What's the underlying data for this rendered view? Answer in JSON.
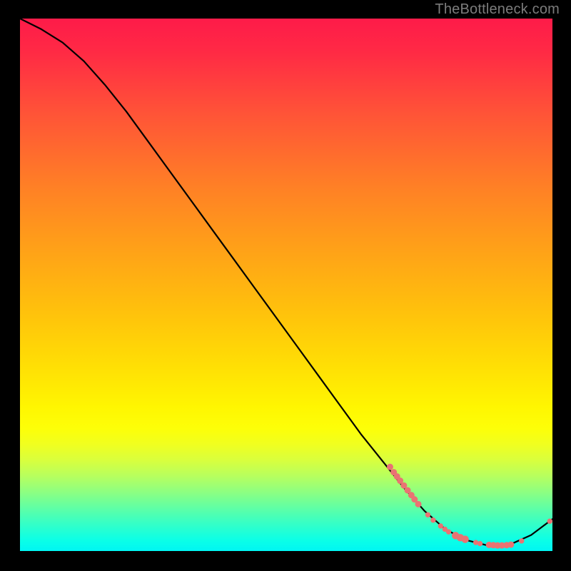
{
  "attribution": "TheBottleneck.com",
  "chart_data": {
    "type": "line",
    "title": "",
    "xlabel": "",
    "ylabel": "",
    "xlim": [
      0,
      100
    ],
    "ylim": [
      0,
      100
    ],
    "grid": false,
    "legend": false,
    "series": [
      {
        "name": "bottleneck-curve",
        "style": "line",
        "color": "#000000",
        "x": [
          0,
          4,
          8,
          12,
          16,
          20,
          24,
          28,
          32,
          36,
          40,
          44,
          48,
          52,
          56,
          60,
          64,
          68,
          72,
          76,
          80,
          84,
          88,
          92,
          96,
          100
        ],
        "y": [
          100,
          98,
          95.5,
          92,
          87.5,
          82.5,
          77,
          71.5,
          66,
          60.5,
          55,
          49.5,
          44,
          38.5,
          33,
          27.5,
          22,
          17,
          12,
          7.5,
          4,
          2,
          1,
          1.2,
          3,
          6
        ]
      },
      {
        "name": "markers",
        "style": "scatter",
        "color": "#e97373",
        "points": [
          {
            "x": 69.5,
            "y": 15.8,
            "r": 4.5
          },
          {
            "x": 70.2,
            "y": 14.8,
            "r": 4.5
          },
          {
            "x": 70.8,
            "y": 14.0,
            "r": 4.5
          },
          {
            "x": 71.4,
            "y": 13.2,
            "r": 4.5
          },
          {
            "x": 72.1,
            "y": 12.3,
            "r": 4.5
          },
          {
            "x": 72.8,
            "y": 11.4,
            "r": 4.5
          },
          {
            "x": 73.5,
            "y": 10.5,
            "r": 4.5
          },
          {
            "x": 74.1,
            "y": 9.7,
            "r": 4.5
          },
          {
            "x": 74.8,
            "y": 8.8,
            "r": 4.5
          },
          {
            "x": 76.6,
            "y": 6.8,
            "r": 3.7
          },
          {
            "x": 77.6,
            "y": 5.8,
            "r": 3.7
          },
          {
            "x": 79.0,
            "y": 4.7,
            "r": 3.7
          },
          {
            "x": 79.8,
            "y": 4.1,
            "r": 3.7
          },
          {
            "x": 80.5,
            "y": 3.6,
            "r": 3.7
          },
          {
            "x": 81.8,
            "y": 2.9,
            "r": 5.2
          },
          {
            "x": 82.7,
            "y": 2.5,
            "r": 5.2
          },
          {
            "x": 83.6,
            "y": 2.2,
            "r": 5.2
          },
          {
            "x": 85.6,
            "y": 1.6,
            "r": 3.7
          },
          {
            "x": 86.4,
            "y": 1.4,
            "r": 3.7
          },
          {
            "x": 88.1,
            "y": 1.15,
            "r": 4.5
          },
          {
            "x": 88.9,
            "y": 1.1,
            "r": 4.5
          },
          {
            "x": 89.7,
            "y": 1.05,
            "r": 4.5
          },
          {
            "x": 90.5,
            "y": 1.05,
            "r": 4.5
          },
          {
            "x": 91.4,
            "y": 1.1,
            "r": 4.5
          },
          {
            "x": 92.2,
            "y": 1.2,
            "r": 4.5
          },
          {
            "x": 94.2,
            "y": 1.9,
            "r": 3.7
          },
          {
            "x": 99.5,
            "y": 5.6,
            "r": 3.7
          }
        ]
      }
    ],
    "background_gradient": {
      "orientation": "vertical",
      "stops": [
        {
          "pos": 0.0,
          "color": "#fe1b49"
        },
        {
          "pos": 0.5,
          "color": "#ffbf0c"
        },
        {
          "pos": 0.75,
          "color": "#fcff05"
        },
        {
          "pos": 1.0,
          "color": "#00f6f3"
        }
      ]
    }
  }
}
